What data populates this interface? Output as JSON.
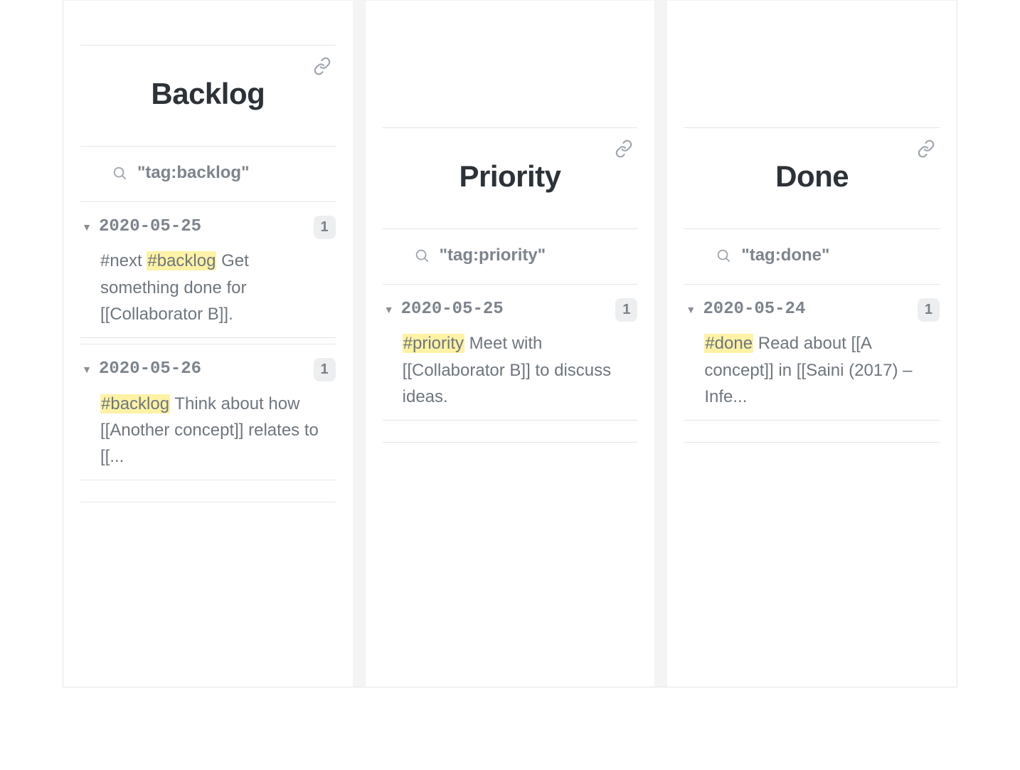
{
  "columns": [
    {
      "title": "Backlog",
      "searchQuery": "\"tag:backlog\"",
      "groups": [
        {
          "date": "2020-05-25",
          "count": "1",
          "note": {
            "pre": "#next ",
            "hl": "#backlog",
            "post": " Get something done for [[Collaborator B]]."
          }
        },
        {
          "date": "2020-05-26",
          "count": "1",
          "note": {
            "pre": "",
            "hl": "#backlog",
            "post": " Think about how [[Another concept]] relates to [[..."
          }
        }
      ]
    },
    {
      "title": "Priority",
      "searchQuery": "\"tag:priority\"",
      "groups": [
        {
          "date": "2020-05-25",
          "count": "1",
          "note": {
            "pre": "",
            "hl": "#priority",
            "post": " Meet with [[Collaborator B]] to discuss ideas."
          }
        }
      ]
    },
    {
      "title": "Done",
      "searchQuery": "\"tag:done\"",
      "groups": [
        {
          "date": "2020-05-24",
          "count": "1",
          "note": {
            "pre": "",
            "hl": "#done",
            "post": " Read about [[A concept]] in [[Saini (2017) – Infe..."
          }
        }
      ]
    }
  ]
}
